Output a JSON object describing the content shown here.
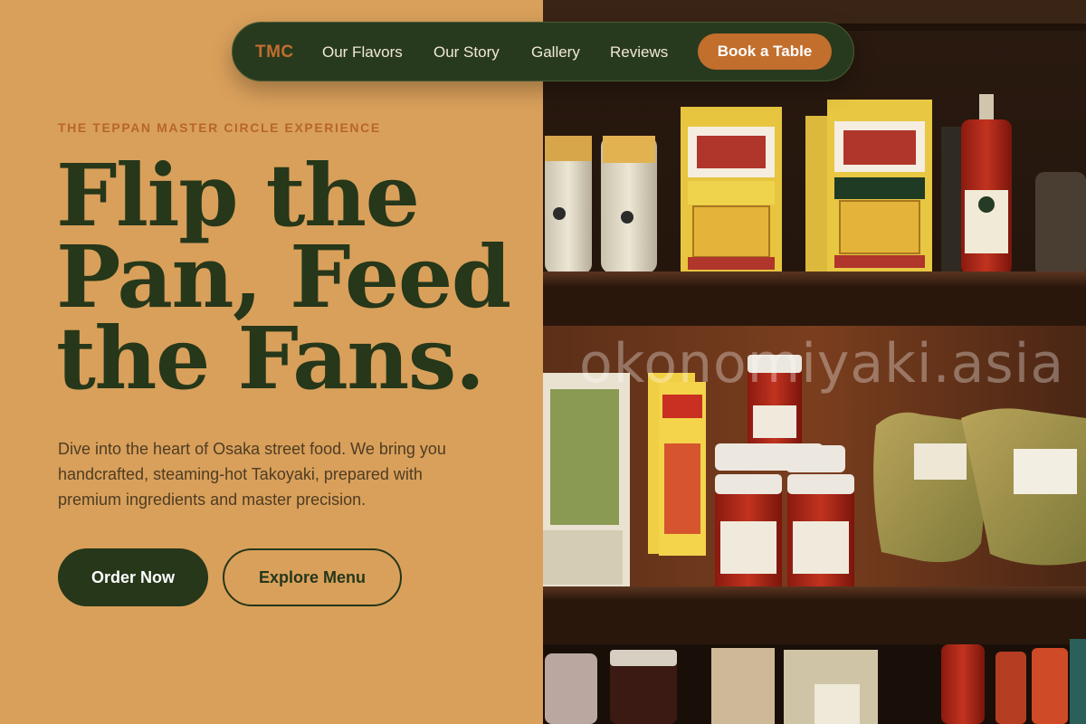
{
  "nav": {
    "brand": "TMC",
    "links": [
      "Our Flavors",
      "Our Story",
      "Gallery",
      "Reviews"
    ],
    "cta": "Book a Table"
  },
  "hero": {
    "eyebrow": "THE TEPPAN MASTER CIRCLE EXPERIENCE",
    "headline_lines": [
      "Flip the",
      "Pan, Feed",
      "the Fans."
    ],
    "subtext": "Dive into the heart of Osaka street food. We bring you handcrafted, steaming-hot Takoyaki, prepared with premium ingredients and master precision.",
    "primary_button": "Order Now",
    "secondary_button": "Explore Menu"
  },
  "photo": {
    "watermark": "okonomiyaki.asia"
  },
  "colors": {
    "background": "#D9A05B",
    "dark_green": "#26371A",
    "accent_orange": "#C26E2D",
    "nav_text": "#F1E8D6"
  }
}
